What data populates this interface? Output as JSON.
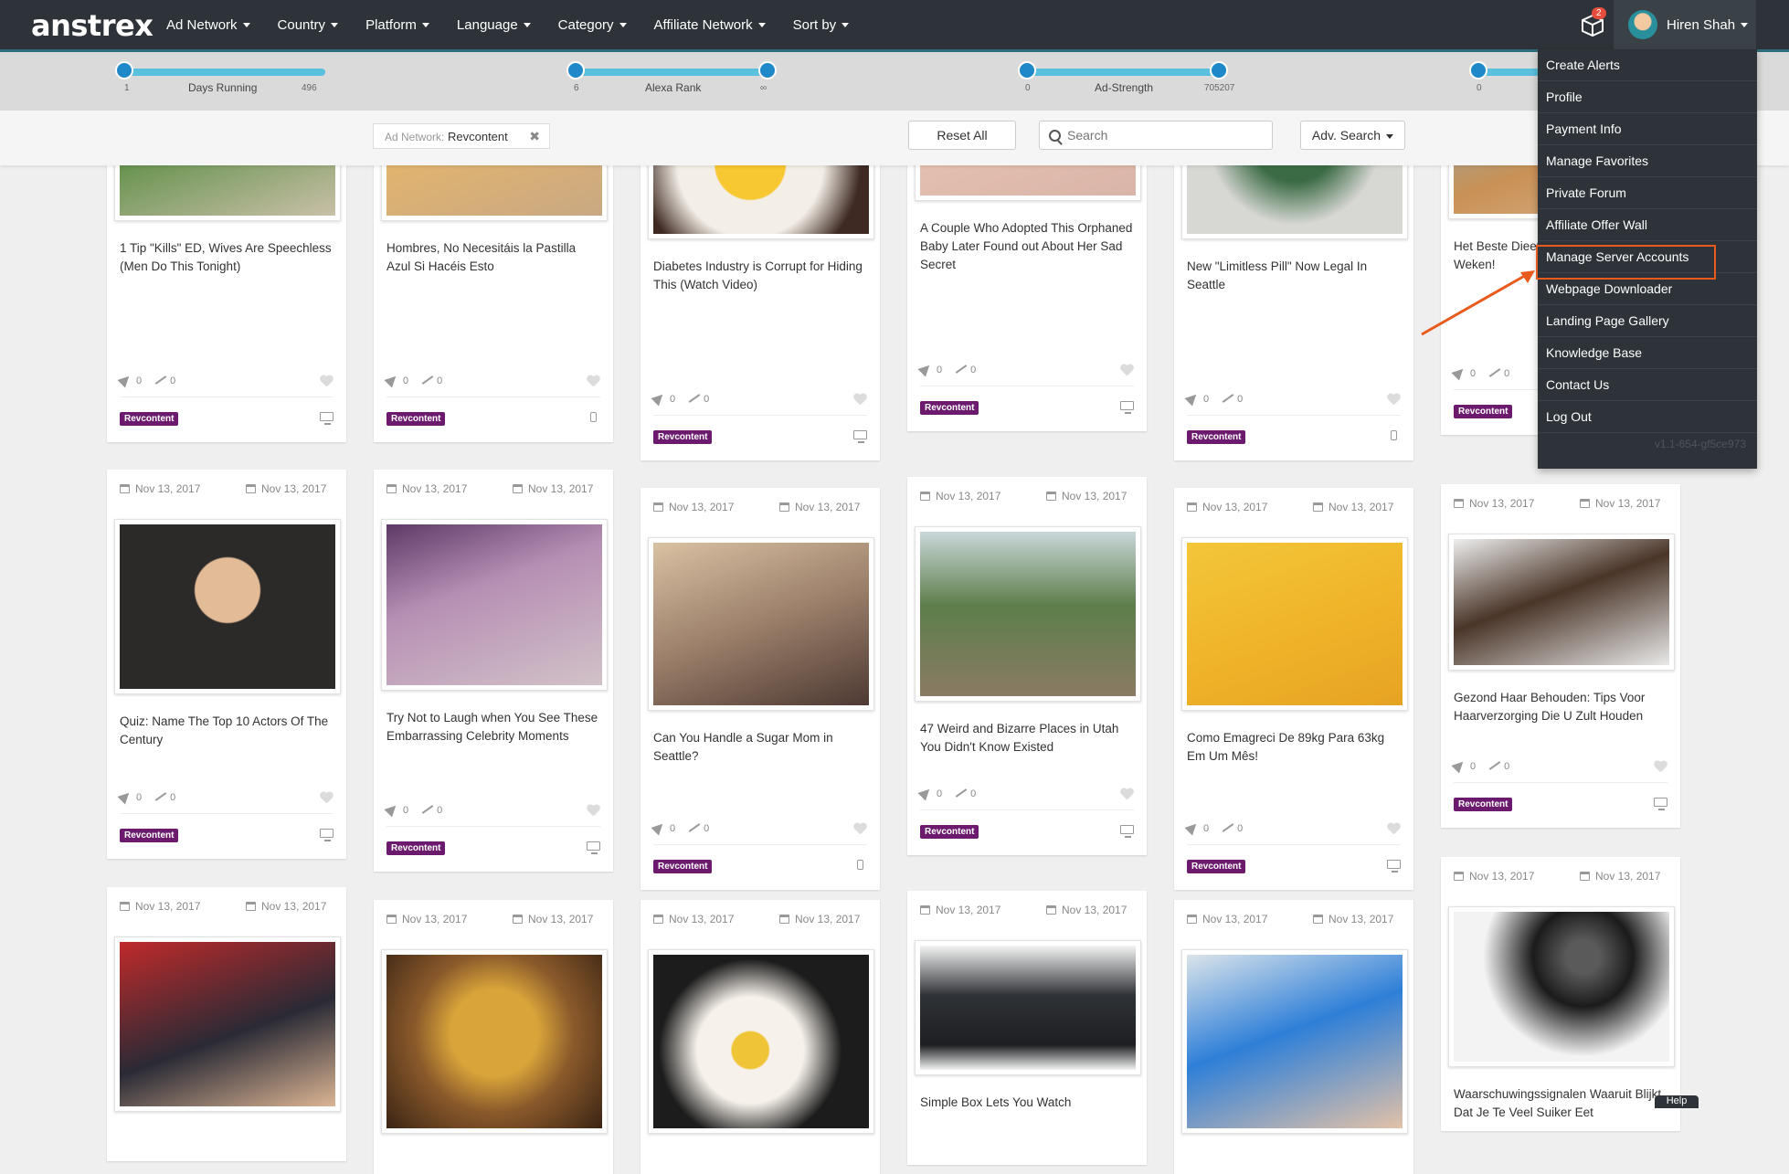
{
  "logo": "anstrex",
  "nav": {
    "menus": [
      "Ad Network",
      "Country",
      "Platform",
      "Language",
      "Category",
      "Affiliate Network",
      "Sort by"
    ],
    "notifications_count": "2",
    "user_name": "Hiren Shah"
  },
  "sliders": [
    {
      "label": "Days Running",
      "min": "1",
      "max": "496"
    },
    {
      "label": "Alexa Rank",
      "min": "6",
      "max": "∞"
    },
    {
      "label": "Ad-Strength",
      "min": "0",
      "max": "705207"
    },
    {
      "label": "",
      "min": "0",
      "max": ""
    }
  ],
  "filter": {
    "tag_key": "Ad Network:",
    "tag_value": "Revcontent",
    "reset_label": "Reset All",
    "search_placeholder": "Search",
    "adv_search_label": "Adv. Search"
  },
  "user_menu": {
    "items": [
      "Create Alerts",
      "Profile",
      "Payment Info",
      "Manage Favorites",
      "Private Forum",
      "Affiliate Offer Wall",
      "Manage Server Accounts",
      "Webpage Downloader",
      "Landing Page Gallery",
      "Knowledge Base",
      "Contact Us",
      "Log Out"
    ],
    "highlighted": "Manage Server Accounts",
    "version": "v1.1-654-gf5ce973"
  },
  "help_label": "Help",
  "cards": [
    {
      "date_first": "",
      "date_last": "",
      "title": "1 Tip \"Kills\" ED, Wives Are Speechless (Men Do This Tonight)",
      "rockets": "0",
      "trend": "0",
      "badge": "Revcontent",
      "device": "desktop"
    },
    {
      "date_first": "",
      "date_last": "",
      "title": "Hombres, No Necesitáis la Pastilla Azul Si Hacéis Esto",
      "rockets": "0",
      "trend": "0",
      "badge": "Revcontent",
      "device": "mobile"
    },
    {
      "date_first": "",
      "date_last": "",
      "title": "Diabetes Industry is Corrupt for Hiding This (Watch Video)",
      "rockets": "0",
      "trend": "0",
      "badge": "Revcontent",
      "device": "desktop"
    },
    {
      "date_first": "",
      "date_last": "",
      "title": "A Couple Who Adopted This Orphaned Baby Later Found out About Her Sad Secret",
      "rockets": "0",
      "trend": "0",
      "badge": "Revcontent",
      "device": "desktop"
    },
    {
      "date_first": "",
      "date_last": "",
      "title": "New \"Limitless Pill\" Now Legal In Seattle",
      "rockets": "0",
      "trend": "0",
      "badge": "Revcontent",
      "device": "mobile"
    },
    {
      "date_first": "",
      "date_last": "",
      "title": "Het Beste Dieet Geen Zware Training Weken!",
      "rockets": "0",
      "trend": "0",
      "badge": "Revcontent",
      "device": "desktop"
    },
    {
      "date_first": "Nov 13, 2017",
      "date_last": "Nov 13, 2017",
      "title": "Quiz: Name The Top 10 Actors Of The Century",
      "rockets": "0",
      "trend": "0",
      "badge": "Revcontent",
      "device": "desktop"
    },
    {
      "date_first": "Nov 13, 2017",
      "date_last": "Nov 13, 2017",
      "title": "Try Not to Laugh when You See These Embarrassing Celebrity Moments",
      "rockets": "0",
      "trend": "0",
      "badge": "Revcontent",
      "device": "desktop"
    },
    {
      "date_first": "Nov 13, 2017",
      "date_last": "Nov 13, 2017",
      "title": "Can You Handle a Sugar Mom in Seattle?",
      "rockets": "0",
      "trend": "0",
      "badge": "Revcontent",
      "device": "mobile"
    },
    {
      "date_first": "Nov 13, 2017",
      "date_last": "Nov 13, 2017",
      "title": "47 Weird and Bizarre Places in Utah You Didn't Know Existed",
      "rockets": "0",
      "trend": "0",
      "badge": "Revcontent",
      "device": "desktop"
    },
    {
      "date_first": "Nov 13, 2017",
      "date_last": "Nov 13, 2017",
      "title": "Como Emagreci De 89kg Para 63kg Em Um Mês!",
      "rockets": "0",
      "trend": "0",
      "badge": "Revcontent",
      "device": "desktop"
    },
    {
      "date_first": "Nov 13, 2017",
      "date_last": "Nov 13, 2017",
      "title": "Gezond Haar Behouden: Tips Voor Haarverzorging Die U Zult Houden",
      "rockets": "0",
      "trend": "0",
      "badge": "Revcontent",
      "device": "desktop"
    },
    {
      "date_first": "Nov 13, 2017",
      "date_last": "Nov 13, 2017",
      "title": "",
      "rockets": "",
      "trend": "",
      "badge": "",
      "device": ""
    },
    {
      "date_first": "Nov 13, 2017",
      "date_last": "Nov 13, 2017",
      "title": "",
      "rockets": "",
      "trend": "",
      "badge": "",
      "device": ""
    },
    {
      "date_first": "Nov 13, 2017",
      "date_last": "Nov 13, 2017",
      "title": "",
      "rockets": "",
      "trend": "",
      "badge": "",
      "device": ""
    },
    {
      "date_first": "Nov 13, 2017",
      "date_last": "Nov 13, 2017",
      "title": "Simple Box Lets You Watch",
      "rockets": "",
      "trend": "",
      "badge": "",
      "device": ""
    },
    {
      "date_first": "Nov 13, 2017",
      "date_last": "Nov 13, 2017",
      "title": "",
      "rockets": "",
      "trend": "",
      "badge": "",
      "device": ""
    },
    {
      "date_first": "Nov 13, 2017",
      "date_last": "Nov 13, 2017",
      "title": "Waarschuwingssignalen Waaruit Blijkt Dat Je Te Veel Suiker Eet",
      "rockets": "",
      "trend": "",
      "badge": "",
      "device": ""
    }
  ]
}
